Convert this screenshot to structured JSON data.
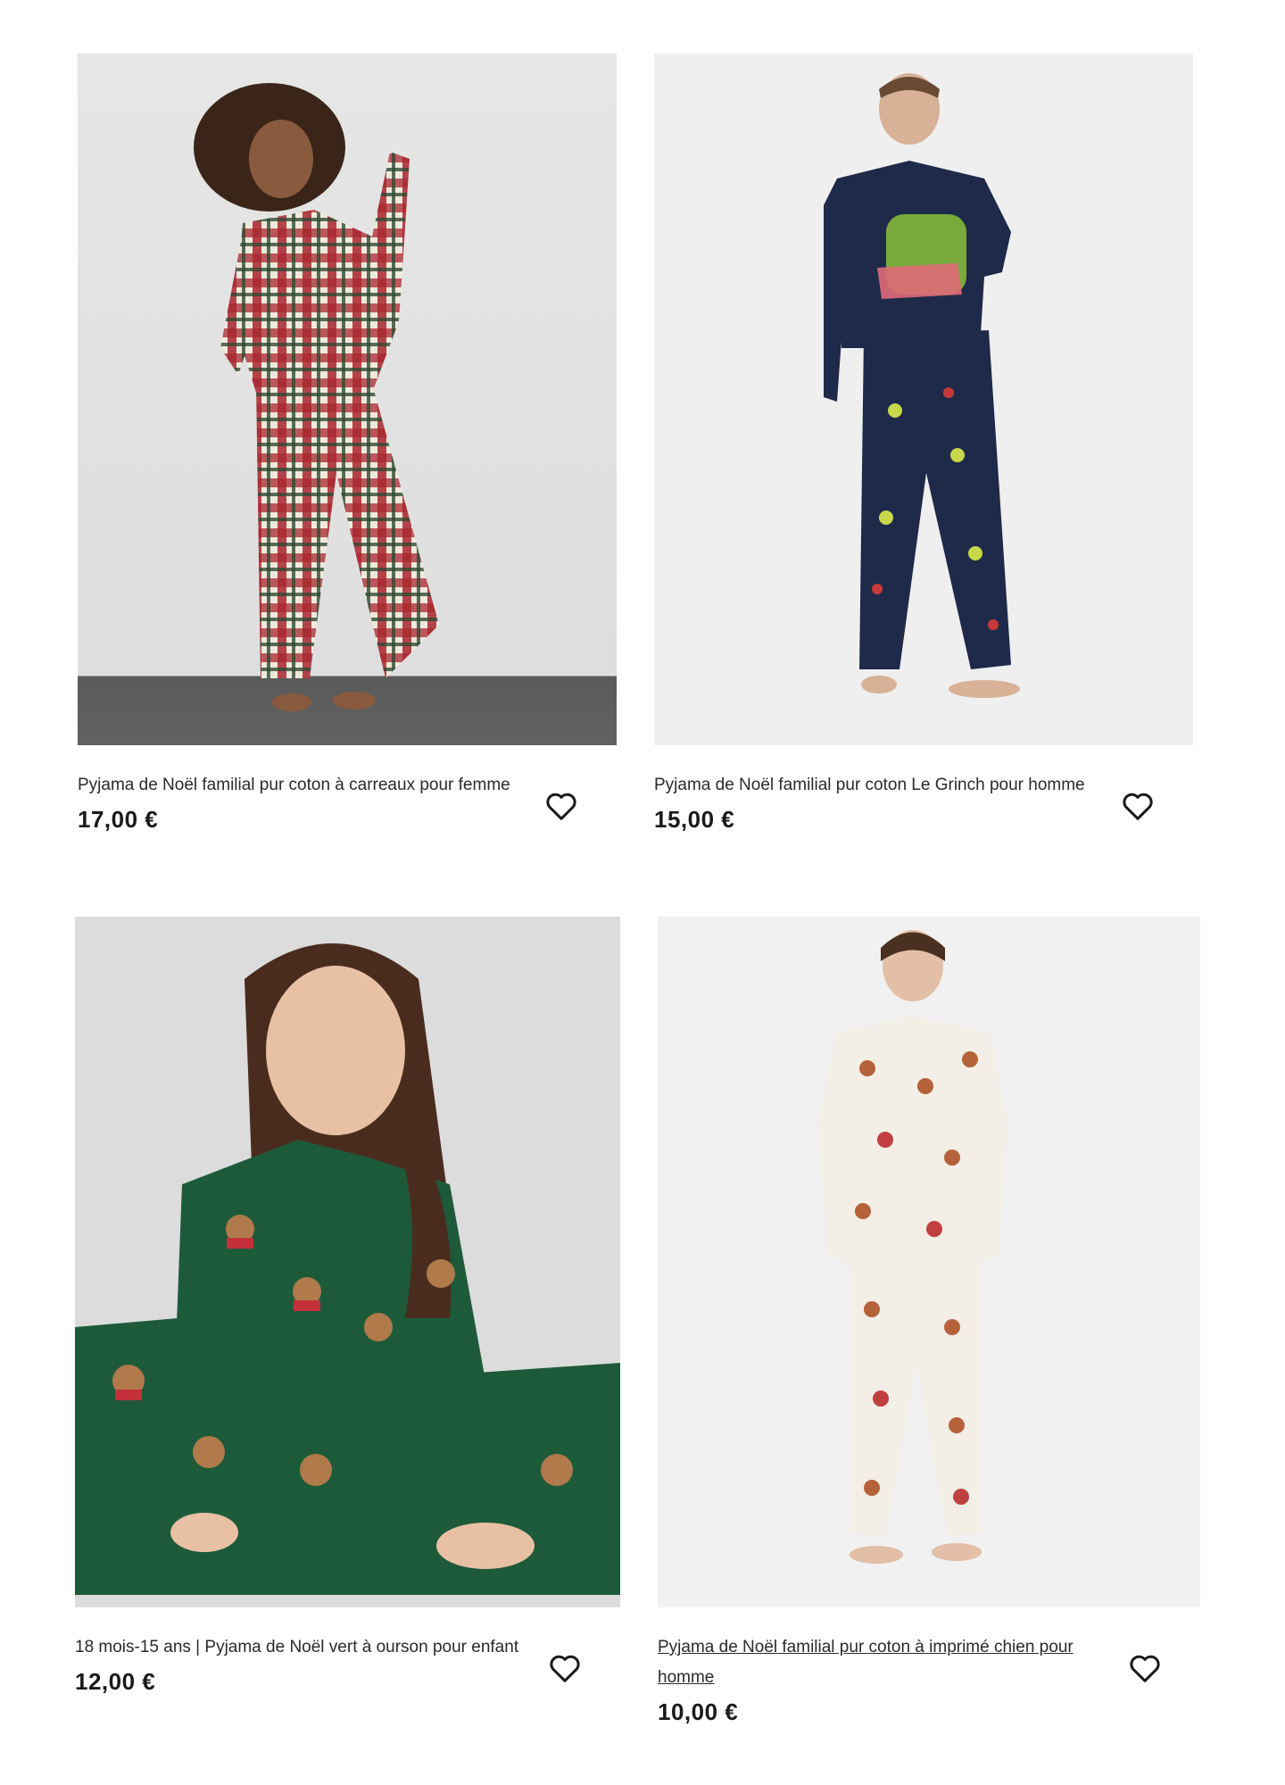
{
  "products": [
    {
      "title": "Pyjama de Noël familial pur coton à carreaux pour femme",
      "price": "17,00 €",
      "favorite_icon": "heart-outline-icon"
    },
    {
      "title": "Pyjama de Noël familial pur coton Le Grinch pour homme",
      "price": "15,00 €",
      "favorite_icon": "heart-outline-icon"
    },
    {
      "title": "18 mois-15 ans | Pyjama de Noël vert à ourson pour enfant",
      "price": "12,00 €",
      "favorite_icon": "heart-outline-icon"
    },
    {
      "title": "Pyjama de Noël familial pur coton à imprimé chien pour homme",
      "price": "10,00 €",
      "favorite_icon": "heart-outline-icon"
    }
  ],
  "colors": {
    "text": "#1a1a1a",
    "background": "#ffffff",
    "plaid_red": "#a8262f",
    "plaid_green": "#2f4a32",
    "navy": "#1f2a4a",
    "forest_green": "#1d5a3a",
    "cream": "#f3eee6"
  }
}
